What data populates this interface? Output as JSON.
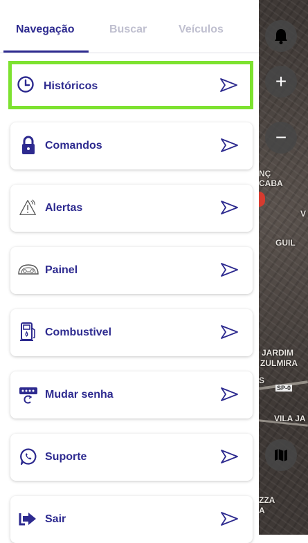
{
  "tabs": [
    {
      "label": "Navegação",
      "active": true
    },
    {
      "label": "Buscar",
      "active": false
    },
    {
      "label": "Veículos",
      "active": false
    }
  ],
  "menu": [
    {
      "label": "Históricos",
      "icon": "clock-icon",
      "selected": true
    },
    {
      "label": "Comandos",
      "icon": "lock-icon"
    },
    {
      "label": "Alertas",
      "icon": "alert-icon"
    },
    {
      "label": "Painel",
      "icon": "dashboard-icon"
    },
    {
      "label": "Combustivel",
      "icon": "fuel-icon"
    },
    {
      "label": "Mudar senha",
      "icon": "password-icon"
    },
    {
      "label": "Suporte",
      "icon": "whatsapp-icon"
    },
    {
      "label": "Sair",
      "icon": "logout-icon"
    }
  ],
  "map": {
    "places": [
      "NÇ",
      "CABA",
      "V",
      "GUIL",
      "JARDIM",
      "ZULMIRA",
      "S",
      "SP-0",
      "VILA JA",
      "ZZA",
      "A"
    ],
    "buttons": [
      "bell-icon",
      "zoom-in-icon",
      "zoom-out-icon",
      "map-layers-icon"
    ],
    "zoom_in": "+",
    "zoom_out": "−"
  },
  "colors": {
    "accent": "#2d2a8f",
    "selected_border": "#7de230",
    "tab_inactive": "#bfbfcf"
  }
}
